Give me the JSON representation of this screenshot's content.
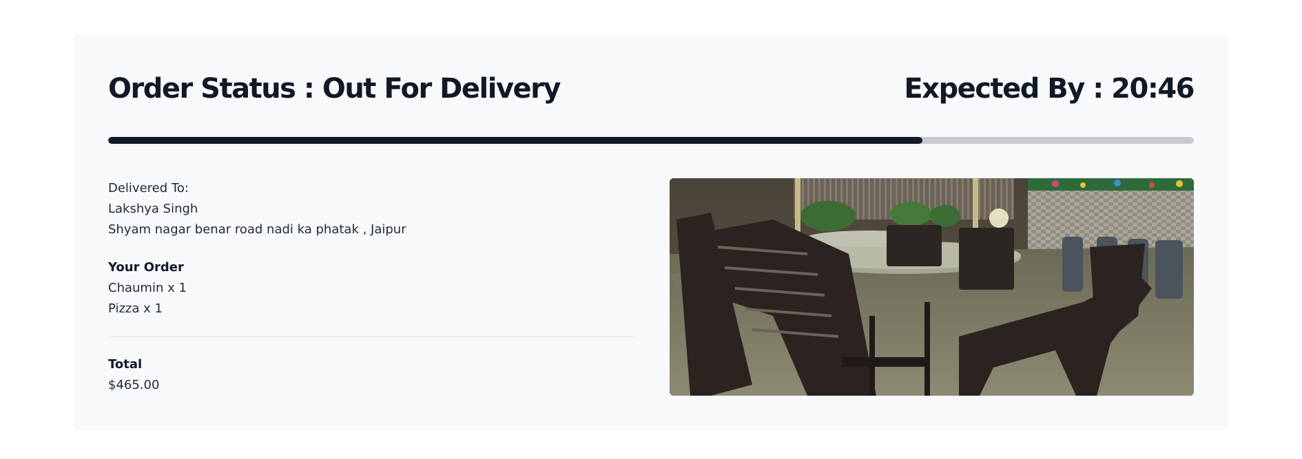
{
  "order": {
    "status_text": "Order Status : Out For Delivery",
    "expected_text": "Expected By : 20:46",
    "progress_percent": 75
  },
  "delivery": {
    "heading": "Delivered To:",
    "name": "Lakshya Singh",
    "address": "Shyam nagar benar road nadi ka phatak , Jaipur"
  },
  "items_section": {
    "heading": "Your Order",
    "items": [
      "Chaumin x 1",
      "Pizza x 1"
    ]
  },
  "total": {
    "heading": "Total",
    "amount": "$465.00"
  },
  "colors": {
    "progress_fill": "#141a2a",
    "progress_track": "#c9cacf",
    "card_background": "#f8f9fa"
  }
}
